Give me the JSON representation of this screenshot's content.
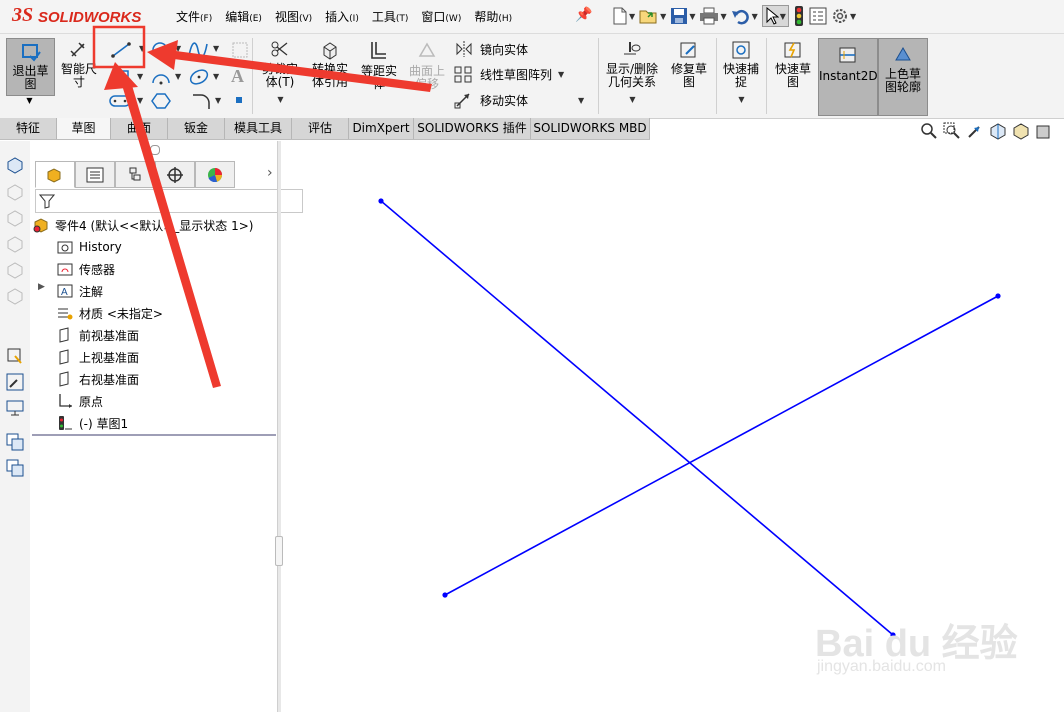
{
  "app": {
    "logo_ds": "3S",
    "logo_text": "SOLIDWORKS"
  },
  "menu": [
    {
      "label": "文件",
      "key": "(F)"
    },
    {
      "label": "编辑",
      "key": "(E)"
    },
    {
      "label": "视图",
      "key": "(V)"
    },
    {
      "label": "插入",
      "key": "(I)"
    },
    {
      "label": "工具",
      "key": "(T)"
    },
    {
      "label": "窗口",
      "key": "(W)"
    },
    {
      "label": "帮助",
      "key": "(H)"
    }
  ],
  "ribbon": {
    "exit_sketch": [
      "退出草",
      "图"
    ],
    "smart_dim": [
      "智能尺",
      "寸"
    ],
    "trim": [
      "剪裁实",
      "体(T)"
    ],
    "convert": [
      "转换实",
      "体引用"
    ],
    "offset": [
      "等距实",
      "体"
    ],
    "surface_offset": [
      "曲面上",
      "偏移"
    ],
    "mirror": "镜向实体",
    "linear_pattern": "线性草图阵列",
    "move": "移动实体",
    "relations": [
      "显示/删除",
      "几何关系"
    ],
    "repair": [
      "修复草",
      "图"
    ],
    "quick_snap": [
      "快速捕",
      "捉"
    ],
    "rapid_sketch": [
      "快速草",
      "图"
    ],
    "instant2d": "Instant2D",
    "shaded": [
      "上色草",
      "图轮廓"
    ]
  },
  "tabs": [
    "特征",
    "草图",
    "曲面",
    "钣金",
    "模具工具",
    "评估",
    "DimXpert",
    "SOLIDWORKS 插件",
    "SOLIDWORKS MBD"
  ],
  "active_tab": "草图",
  "tree": {
    "root": "零件4  (默认<<默认>_显示状态 1>)",
    "items": [
      "History",
      "传感器",
      "注解",
      "材质 <未指定>",
      "前视基准面",
      "上视基准面",
      "右视基准面",
      "原点",
      "(-) 草图1"
    ]
  },
  "watermark": {
    "main": "Bai du 经验",
    "sub": "jingyan.baidu.com"
  },
  "colors": {
    "sketch_line": "#0000ff",
    "arrow": "#ee3a2e",
    "brand": "#da291c"
  },
  "sketch": {
    "units": "screen sketch coordinates",
    "lines": [
      {
        "from": [
          381,
          201
        ],
        "to": [
          893,
          635
        ]
      },
      {
        "from": [
          998,
          296
        ],
        "to": [
          445,
          595
        ]
      }
    ]
  }
}
